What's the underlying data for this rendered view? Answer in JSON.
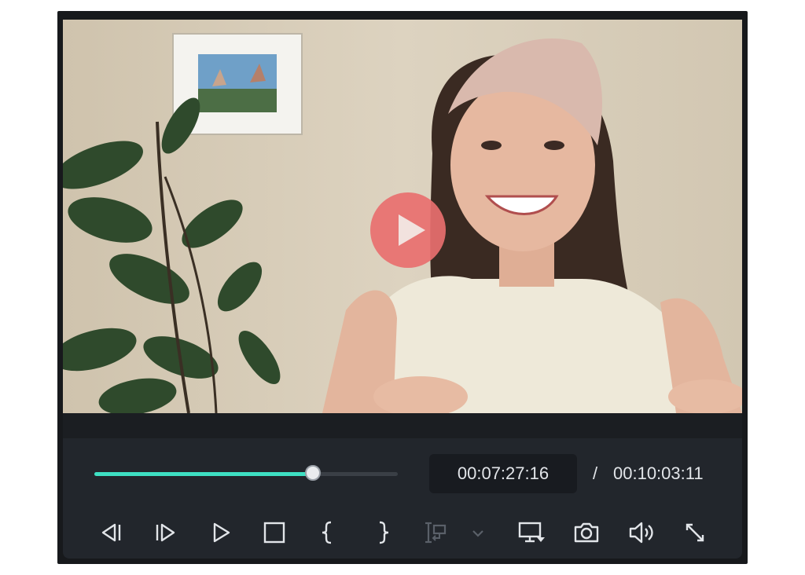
{
  "player": {
    "progress": 0.72,
    "current_time": "00:07:27:16",
    "separator": "/",
    "total_time": "00:10:03:11"
  },
  "controls": [
    {
      "name": "previous-frame-button",
      "icon": "previous-frame-icon",
      "enabled": true
    },
    {
      "name": "next-frame-button",
      "icon": "next-frame-icon",
      "enabled": true
    },
    {
      "name": "play-button",
      "icon": "play-icon",
      "enabled": true
    },
    {
      "name": "stop-button",
      "icon": "stop-icon",
      "enabled": true
    },
    {
      "name": "mark-in-button",
      "icon": "mark-in-icon",
      "enabled": true
    },
    {
      "name": "mark-out-button",
      "icon": "mark-out-icon",
      "enabled": true
    },
    {
      "name": "insert-clip-button",
      "icon": "insert-clip-icon",
      "enabled": false
    },
    {
      "name": "insert-options-dropdown",
      "icon": "chevron-down-icon",
      "enabled": false
    },
    {
      "name": "display-settings-button",
      "icon": "monitor-dropdown-icon",
      "enabled": true
    },
    {
      "name": "snapshot-button",
      "icon": "camera-icon",
      "enabled": true
    },
    {
      "name": "volume-button",
      "icon": "speaker-icon",
      "enabled": true
    },
    {
      "name": "fullscreen-button",
      "icon": "expand-icon",
      "enabled": true
    }
  ],
  "colors": {
    "progress_fill": "#3ee0c3",
    "play_overlay": "#e86f6f",
    "panel_bg": "#22262c",
    "icon": "#e2e5e9",
    "icon_disabled": "#5a6069"
  }
}
